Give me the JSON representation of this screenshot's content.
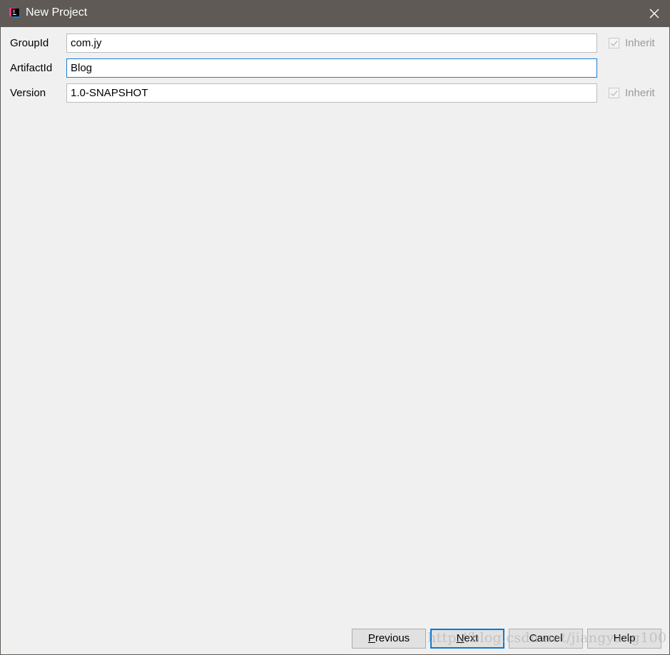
{
  "window": {
    "title": "New Project",
    "app_icon": "intellij-idea-icon",
    "close_icon": "close-icon"
  },
  "form": {
    "group_id": {
      "label": "GroupId",
      "value": "com.jy",
      "inherit_label": "Inherit",
      "inherit_checked": true,
      "inherit_enabled": false
    },
    "artifact_id": {
      "label": "ArtifactId",
      "value": "Blog",
      "focused": true
    },
    "version": {
      "label": "Version",
      "value": "1.0-SNAPSHOT",
      "inherit_label": "Inherit",
      "inherit_checked": true,
      "inherit_enabled": false
    }
  },
  "buttons": {
    "previous": {
      "mnemonic": "P",
      "rest": "revious"
    },
    "next": {
      "mnemonic": "N",
      "rest": "ext"
    },
    "cancel": "Cancel",
    "help": "Help"
  },
  "watermark": "http://blog.csdn.net/jiangyang100",
  "colors": {
    "titlebar": "#5f5a55",
    "focus_border": "#1a7cd4",
    "default_button_border": "#0a78d7",
    "background": "#f0f0f0"
  }
}
